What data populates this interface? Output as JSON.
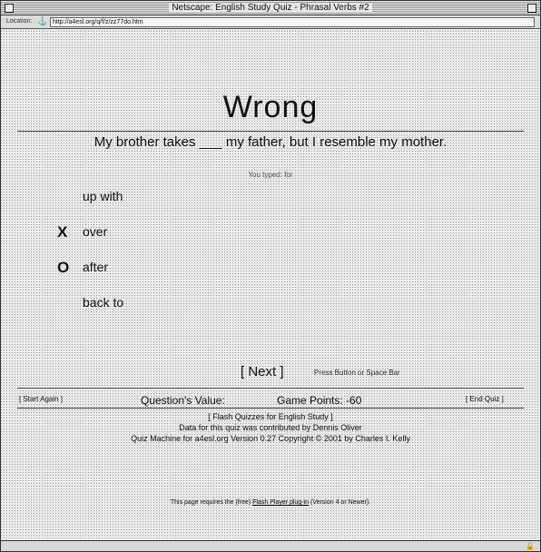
{
  "window": {
    "title": "Netscape: English Study Quiz - Phrasal Verbs #2"
  },
  "location": {
    "label": "Location:",
    "url": "http://a4esl.org/q/f/z/zz77do.htm"
  },
  "result": {
    "heading": "Wrong"
  },
  "question": {
    "text": "My brother takes ___ my father, but I resemble my mother."
  },
  "typed_label": "You typed: for",
  "answers": [
    {
      "mark": "",
      "text": "up with"
    },
    {
      "mark": "X",
      "text": "over"
    },
    {
      "mark": "O",
      "text": "after"
    },
    {
      "mark": "",
      "text": "back to"
    }
  ],
  "controls": {
    "next_label": "[ Next ]",
    "next_hint": "Press Button or Space Bar",
    "start_again": "[ Start Again ]",
    "question_value": "Question's Value:",
    "game_points": "Game Points: -60",
    "end_quiz": "[ End Quiz ]"
  },
  "footer": {
    "line1": "[ Flash Quizzes for English Study ]",
    "line2": "Data for this quiz was contributed by Dennis Oliver",
    "line3": "Quiz Machine for a4esl.org Version 0.27    Copyright © 2001 by Charles I. Kelly"
  },
  "requirement": {
    "prefix": "This page requires the (free) ",
    "link": "Flash Player plug-in",
    "suffix": " (Version 4 or Newer)."
  }
}
